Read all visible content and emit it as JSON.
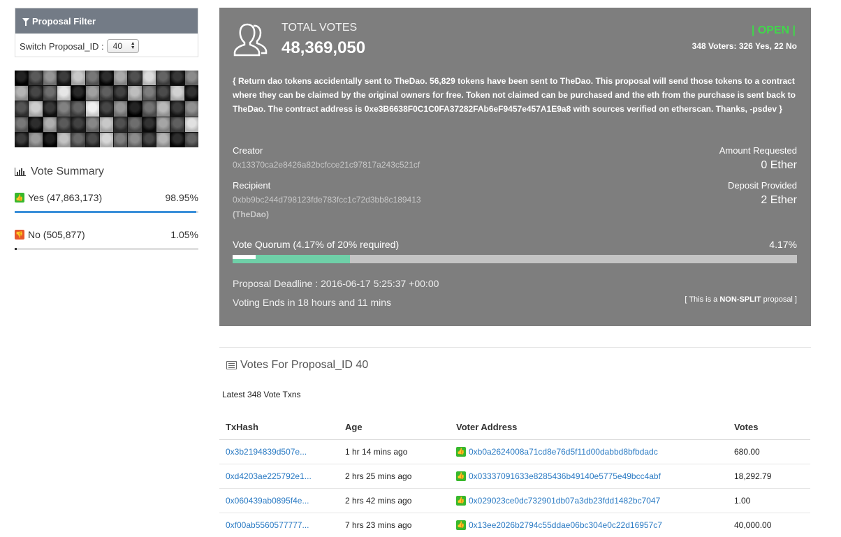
{
  "filter": {
    "title": "Proposal Filter",
    "switch_label": "Switch Proposal_ID :",
    "selected_id": "40"
  },
  "summary": {
    "title": "Vote Summary",
    "yes_label": "Yes (47,863,173)",
    "yes_pct": "98.95%",
    "yes_fraction": 0.9895,
    "no_label": "No (505,877)",
    "no_pct": "1.05%",
    "no_fraction": 0.0105
  },
  "proposal": {
    "total_votes_label": "TOTAL VOTES",
    "total_votes": "48,369,050",
    "status": "| OPEN |",
    "voters": "348 Voters: 326 Yes, 22 No",
    "description": "{ Return dao tokens accidentally sent to TheDao. 56,829 tokens have been sent to TheDao. This proposal will send those tokens to a contract where they can be claimed by the original owners for free. Token not claimed can be purchased and the eth from the purchase is sent back to TheDao. The contract address is 0xe3B6638F0C1C0FA37282FAb6eF9457e457A1E9a8 with sources verified on etherscan. Thanks, -psdev }",
    "creator_label": "Creator",
    "creator": "0x13370ca2e8426a82bcfcce21c97817a243c521cf",
    "recipient_label": "Recipient",
    "recipient": "0xbb9bc244d798123fde783fcc1c72d3bb8c189413",
    "recipient_name": "(TheDao)",
    "amount_label": "Amount Requested",
    "amount": "0 Ether",
    "deposit_label": "Deposit Provided",
    "deposit": "2 Ether",
    "quorum_label": "Vote Quorum (4.17% of 20% required)",
    "quorum_pct": "4.17%",
    "quorum_fraction": 0.2085,
    "deadline": "Proposal Deadline : 2016-06-17 5:25:37 +00:00",
    "voting_ends": "Voting Ends in 18 hours and 11 mins",
    "split_prefix": "[ This is a ",
    "split_type": "NON-SPLIT",
    "split_suffix": " proposal ]"
  },
  "votes": {
    "title": "Votes For Proposal_ID 40",
    "latest": "Latest 348 Vote Txns",
    "columns": [
      "TxHash",
      "Age",
      "Voter Address",
      "Votes"
    ],
    "rows": [
      {
        "hash": "0x3b2194839d507e...",
        "age": "1 hr 14 mins ago",
        "address": "0xb0a2624008a71cd8e76d5f11d00dabbd8bfbdadc",
        "votes": "680.00"
      },
      {
        "hash": "0xd4203ae225792e1...",
        "age": "2 hrs 25 mins ago",
        "address": "0x03337091633e8285436b49140e5775e49bcc4abf",
        "votes": "18,292.79"
      },
      {
        "hash": "0x060439ab0895f4e...",
        "age": "2 hrs 42 mins ago",
        "address": "0x029023ce0dc732901db07a3db23fdd1482bc7047",
        "votes": "1.00"
      },
      {
        "hash": "0xf00ab5560577777...",
        "age": "7 hrs 23 mins ago",
        "address": "0x13ee2026b2794c55ddae06bc304e0c22d16957c7",
        "votes": "40,000.00"
      }
    ]
  },
  "colors": {
    "panel_bg": "#7e7e7e",
    "open_green": "#41d64c",
    "yes_bar": "#3a8fd9",
    "quorum_fill": "#6fd0a8",
    "link_blue": "#2b7bc4"
  }
}
